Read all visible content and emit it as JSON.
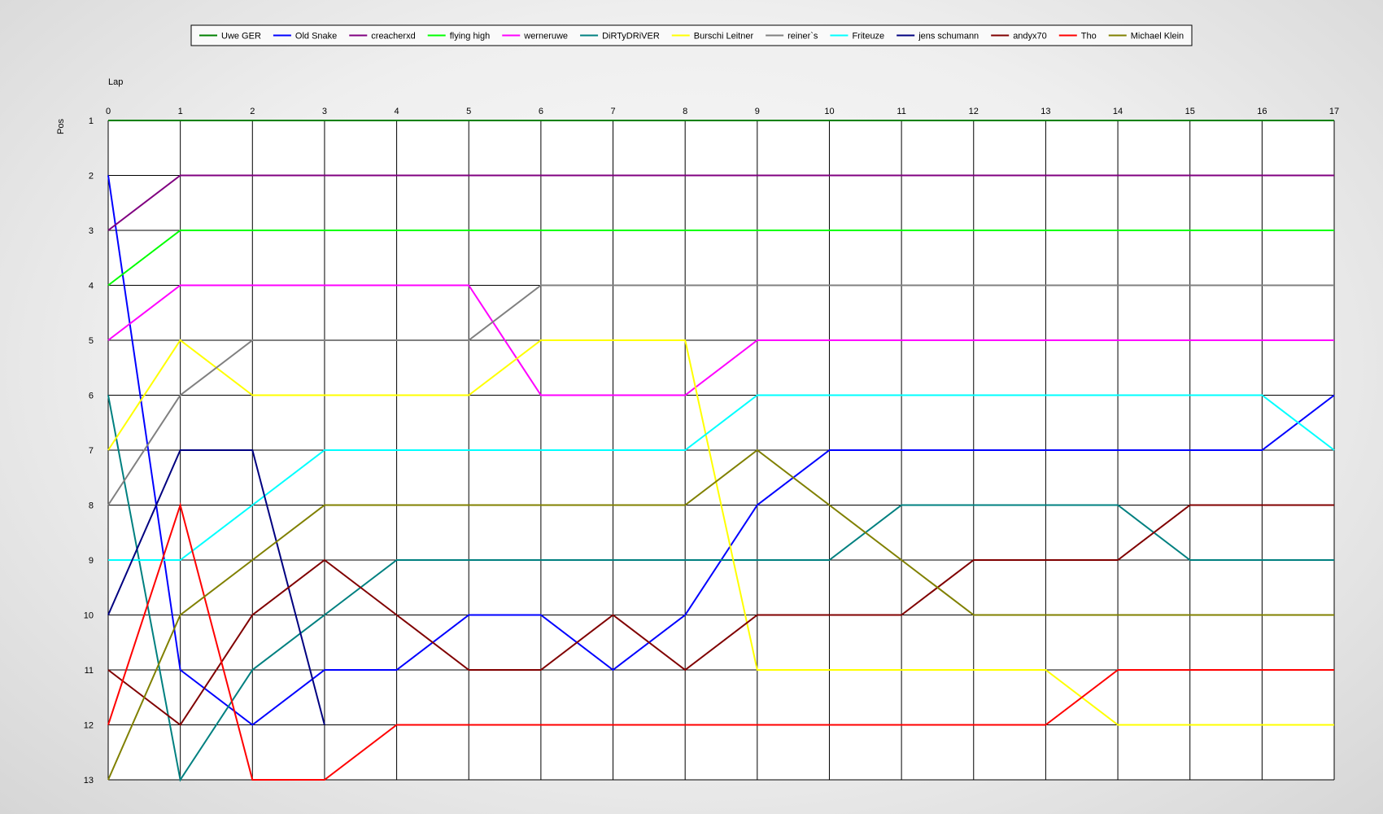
{
  "chart_data": {
    "type": "line",
    "xlabel": "Lap",
    "ylabel": "Pos",
    "grid": true,
    "legend_placement": "top-center",
    "x": [
      0,
      1,
      2,
      3,
      4,
      5,
      6,
      7,
      8,
      9,
      10,
      11,
      12,
      13,
      14,
      15,
      16,
      17
    ],
    "xlim": [
      0,
      17
    ],
    "ylim": [
      1,
      13
    ],
    "y_inverted": true,
    "y_ticks": [
      1,
      2,
      3,
      4,
      5,
      6,
      7,
      8,
      9,
      10,
      11,
      12,
      13
    ],
    "series": [
      {
        "name": "Uwe GER",
        "color": "#008000",
        "values": [
          1,
          1,
          1,
          1,
          1,
          1,
          1,
          1,
          1,
          1,
          1,
          1,
          1,
          1,
          1,
          1,
          1,
          1
        ]
      },
      {
        "name": "Old Snake",
        "color": "#0000FF",
        "values": [
          2,
          11,
          12,
          11,
          11,
          10,
          10,
          11,
          10,
          8,
          7,
          7,
          7,
          7,
          7,
          7,
          7,
          6
        ]
      },
      {
        "name": "creacherxd",
        "color": "#800080",
        "values": [
          3,
          2,
          2,
          2,
          2,
          2,
          2,
          2,
          2,
          2,
          2,
          2,
          2,
          2,
          2,
          2,
          2,
          2
        ]
      },
      {
        "name": "flying high",
        "color": "#00FF00",
        "values": [
          4,
          3,
          3,
          3,
          3,
          3,
          3,
          3,
          3,
          3,
          3,
          3,
          3,
          3,
          3,
          3,
          3,
          3
        ]
      },
      {
        "name": "werneruwe",
        "color": "#FF00FF",
        "values": [
          5,
          4,
          4,
          4,
          4,
          4,
          6,
          6,
          6,
          5,
          5,
          5,
          5,
          5,
          5,
          5,
          5,
          5
        ]
      },
      {
        "name": "DiRTyDRiVER",
        "color": "#008080",
        "values": [
          6,
          13,
          11,
          10,
          9,
          9,
          9,
          9,
          9,
          9,
          9,
          8,
          8,
          8,
          8,
          9,
          9,
          9
        ]
      },
      {
        "name": "Burschi Leitner",
        "color": "#FFFF00",
        "values": [
          7,
          5,
          6,
          6,
          6,
          6,
          5,
          5,
          5,
          11,
          11,
          11,
          11,
          11,
          12,
          12,
          12,
          12
        ]
      },
      {
        "name": "reiner`s",
        "color": "#808080",
        "values": [
          8,
          6,
          5,
          5,
          5,
          5,
          4,
          4,
          4,
          4,
          4,
          4,
          4,
          4,
          4,
          4,
          4,
          4
        ]
      },
      {
        "name": "Friteuze",
        "color": "#00FFFF",
        "values": [
          9,
          9,
          8,
          7,
          7,
          7,
          7,
          7,
          7,
          6,
          6,
          6,
          6,
          6,
          6,
          6,
          6,
          7
        ]
      },
      {
        "name": "jens  schumann",
        "color": "#000080",
        "values": [
          10,
          7,
          7,
          12,
          null,
          null,
          null,
          null,
          null,
          null,
          null,
          null,
          null,
          null,
          null,
          null,
          null,
          null
        ]
      },
      {
        "name": "andyx70",
        "color": "#800000",
        "values": [
          11,
          12,
          10,
          9,
          10,
          11,
          11,
          10,
          11,
          10,
          10,
          10,
          9,
          9,
          9,
          8,
          8,
          8
        ]
      },
      {
        "name": "Tho",
        "color": "#FF0000",
        "values": [
          12,
          8,
          13,
          13,
          12,
          12,
          12,
          12,
          12,
          12,
          12,
          12,
          12,
          12,
          11,
          11,
          11,
          11
        ]
      },
      {
        "name": "Michael Klein",
        "color": "#808000",
        "values": [
          13,
          10,
          9,
          8,
          8,
          8,
          8,
          8,
          8,
          7,
          8,
          9,
          10,
          10,
          10,
          10,
          10,
          10
        ]
      }
    ]
  }
}
